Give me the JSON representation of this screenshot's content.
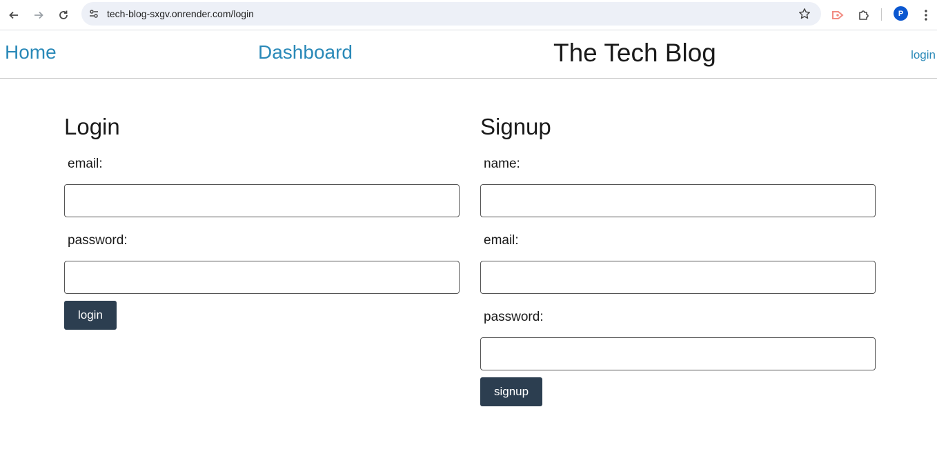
{
  "browser": {
    "url": "tech-blog-sxgv.onrender.com/login",
    "profile_initial": "P"
  },
  "header": {
    "home_label": "Home",
    "dashboard_label": "Dashboard",
    "title": "The Tech Blog",
    "login_label": "login"
  },
  "login_form": {
    "heading": "Login",
    "email_label": "email:",
    "password_label": "password:",
    "submit_label": "login"
  },
  "signup_form": {
    "heading": "Signup",
    "name_label": "name:",
    "email_label": "email:",
    "password_label": "password:",
    "submit_label": "signup"
  },
  "colors": {
    "link": "#2a89b8",
    "button": "#2c3e50",
    "avatar": "#0b57d0"
  }
}
